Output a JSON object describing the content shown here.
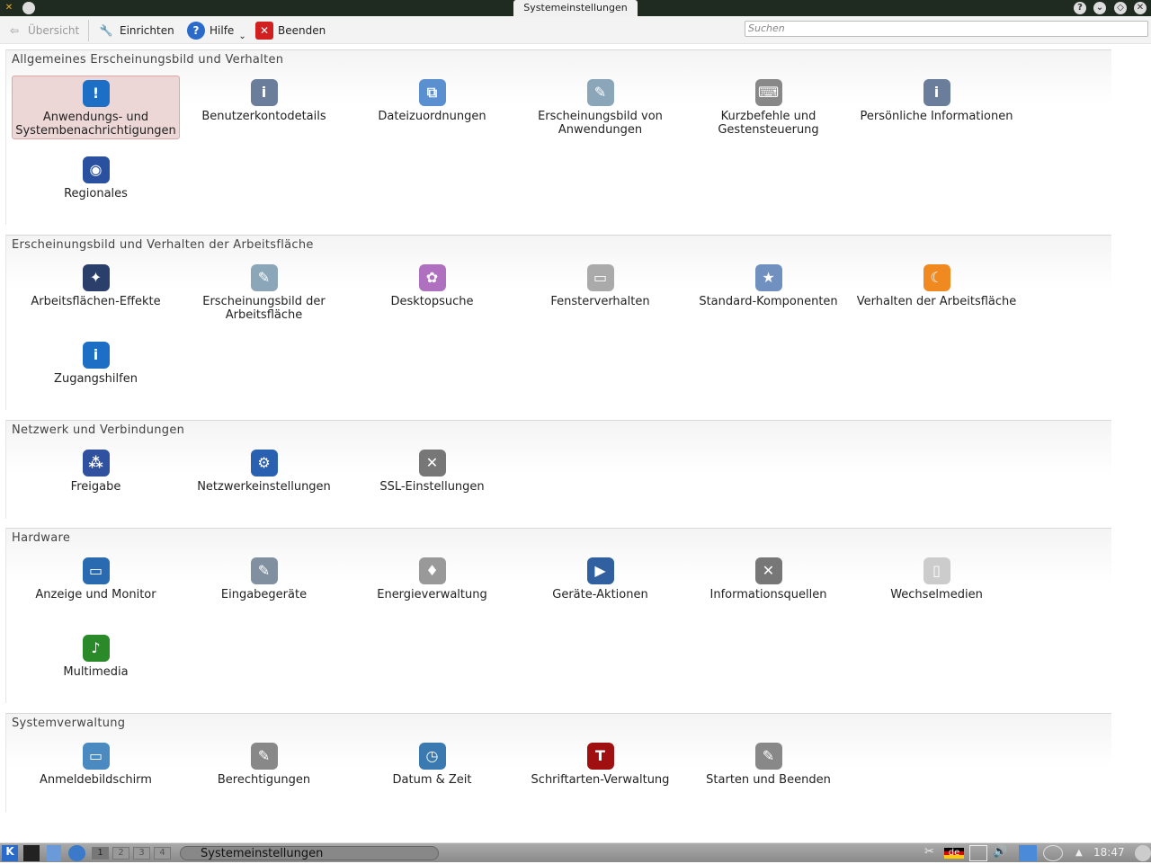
{
  "window": {
    "title": "Systemeinstellungen",
    "controls": [
      "?",
      "⌄",
      "◇",
      "✕"
    ]
  },
  "toolbar": {
    "overview": "Übersicht",
    "configure": "Einrichten",
    "help": "Hilfe",
    "quit": "Beenden",
    "search_placeholder": "Suchen"
  },
  "sections": [
    {
      "title": "Allgemeines Erscheinungsbild und Verhalten",
      "rows": 2,
      "items": [
        {
          "label": "Anwendungs- und Systembenachrichtigungen",
          "icon": "!",
          "color": "#1c6fc4",
          "selected": true
        },
        {
          "label": "Benutzerkontodetails",
          "icon": "i",
          "color": "#6a7d9a"
        },
        {
          "label": "Dateizuordnungen",
          "icon": "⧉",
          "color": "#5a8fd0"
        },
        {
          "label": "Erscheinungsbild von Anwendungen",
          "icon": "✎",
          "color": "#8aa6b8"
        },
        {
          "label": "Kurzbefehle und Gestensteuerung",
          "icon": "⌨",
          "color": "#888"
        },
        {
          "label": "Persönliche Informationen",
          "icon": "i",
          "color": "#6a7d9a"
        },
        {
          "label": "Regionales",
          "icon": "◉",
          "color": "#2a50a0"
        }
      ]
    },
    {
      "title": "Erscheinungsbild und Verhalten der Arbeitsfläche",
      "rows": 2,
      "items": [
        {
          "label": "Arbeitsflächen-Effekte",
          "icon": "✦",
          "color": "#2a3f6a"
        },
        {
          "label": "Erscheinungsbild der Arbeitsfläche",
          "icon": "✎",
          "color": "#8aa6b8"
        },
        {
          "label": "Desktopsuche",
          "icon": "✿",
          "color": "#b070c0"
        },
        {
          "label": "Fensterverhalten",
          "icon": "▭",
          "color": "#aaa"
        },
        {
          "label": "Standard-Komponenten",
          "icon": "★",
          "color": "#7090c0"
        },
        {
          "label": "Verhalten der Arbeitsfläche",
          "icon": "☾",
          "color": "#f08a20"
        },
        {
          "label": "Zugangshilfen",
          "icon": "i",
          "color": "#1c6fc4"
        }
      ]
    },
    {
      "title": "Netzwerk und Verbindungen",
      "rows": 1,
      "items": [
        {
          "label": "Freigabe",
          "icon": "⁂",
          "color": "#3050a0"
        },
        {
          "label": "Netzwerkeinstellungen",
          "icon": "⚙",
          "color": "#2a60b0"
        },
        {
          "label": "SSL-Einstellungen",
          "icon": "✕",
          "color": "#777"
        }
      ]
    },
    {
      "title": "Hardware",
      "rows": 2,
      "items": [
        {
          "label": "Anzeige und Monitor",
          "icon": "▭",
          "color": "#2a6ab0"
        },
        {
          "label": "Eingabegeräte",
          "icon": "✎",
          "color": "#8090a0"
        },
        {
          "label": "Energieverwaltung",
          "icon": "♦",
          "color": "#999"
        },
        {
          "label": "Geräte-Aktionen",
          "icon": "▶",
          "color": "#3060a0"
        },
        {
          "label": "Informationsquellen",
          "icon": "✕",
          "color": "#777"
        },
        {
          "label": "Wechselmedien",
          "icon": "▯",
          "color": "#ccc"
        },
        {
          "label": "Multimedia",
          "icon": "♪",
          "color": "#2a8a2a"
        }
      ]
    },
    {
      "title": "Systemverwaltung",
      "rows": 1,
      "items": [
        {
          "label": "Anmeldebildschirm",
          "icon": "▭",
          "color": "#4a8ac0"
        },
        {
          "label": "Berechtigungen",
          "icon": "✎",
          "color": "#888"
        },
        {
          "label": "Datum & Zeit",
          "icon": "◷",
          "color": "#3a7ab0"
        },
        {
          "label": "Schriftarten-Verwaltung",
          "icon": "T",
          "color": "#a01010"
        },
        {
          "label": "Starten und Beenden",
          "icon": "✎",
          "color": "#888"
        }
      ]
    }
  ],
  "taskbar": {
    "desktops": [
      "1",
      "2",
      "3",
      "4"
    ],
    "task": "Systemeinstellungen",
    "layout": "de",
    "clock": "18:47"
  }
}
